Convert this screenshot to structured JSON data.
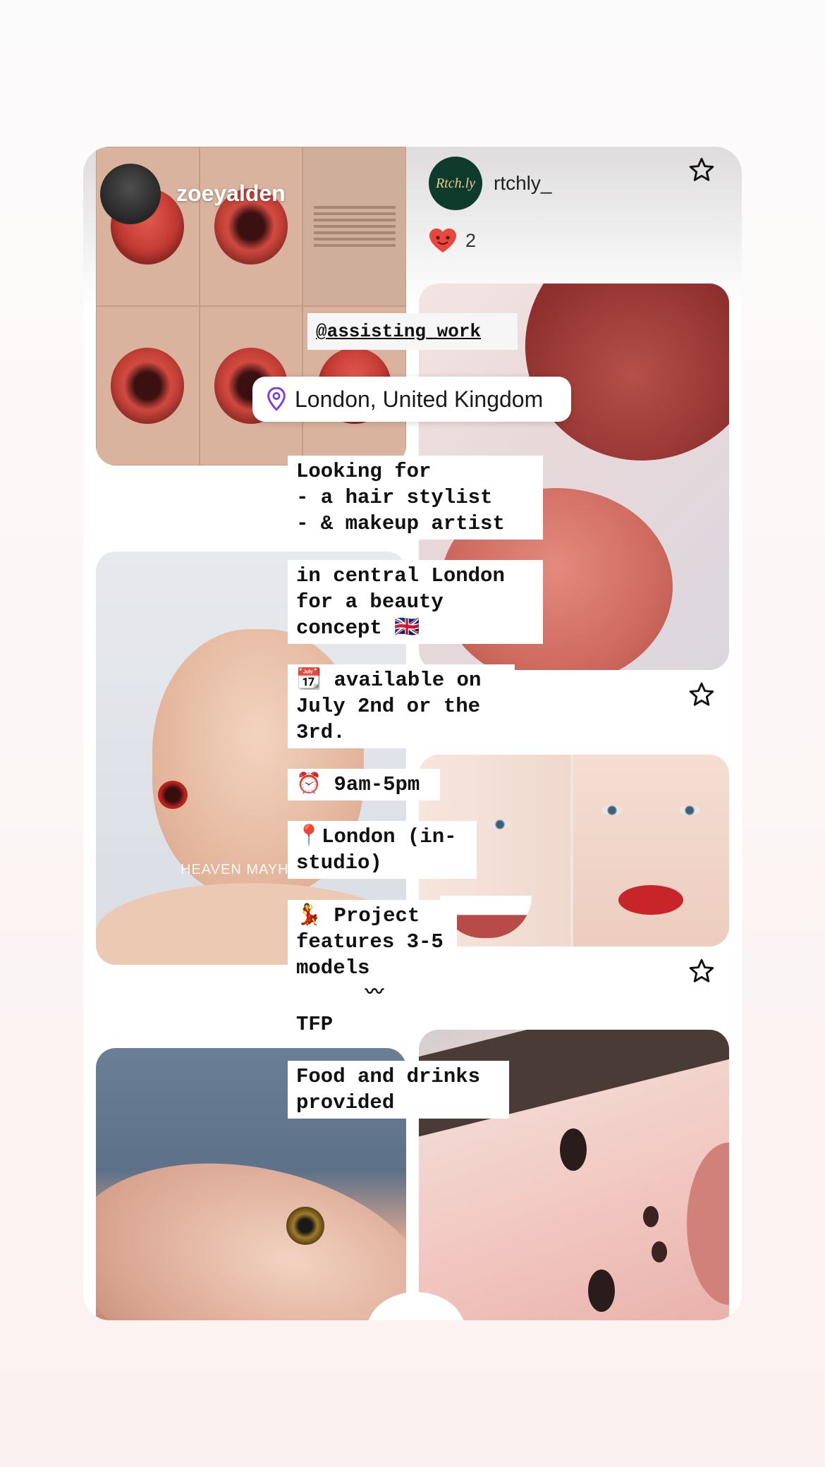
{
  "post_left": {
    "username": "zoeyalden",
    "photo_caption": "HEAVEN MAYH"
  },
  "post_right": {
    "logo_text": "Rtch.ly",
    "username": "rtchly_",
    "like_count": "2"
  },
  "overlay": {
    "handle": "@assisting_work",
    "location": "London, United Kingdom",
    "blocks": [
      "Looking for\n- a hair stylist\n- & makeup artist",
      "in central London\nfor a beauty\nconcept 🇬🇧",
      "📆 available on\nJuly 2nd or the\n3rd.",
      "⏰ 9am-5pm",
      "📍London (in-\nstudio)",
      "💃 Project\nfeatures 3-5\nmodels",
      "〰",
      "TFP",
      "Food and drinks\nprovided"
    ]
  },
  "icons": {
    "star": "star-outline-icon",
    "heart": "heart-emoji-icon",
    "pin": "location-pin-icon"
  },
  "colors": {
    "pin_accent": "#7b3fe4",
    "heart": "#e8473e",
    "logo_bg": "#0f3b2c"
  }
}
